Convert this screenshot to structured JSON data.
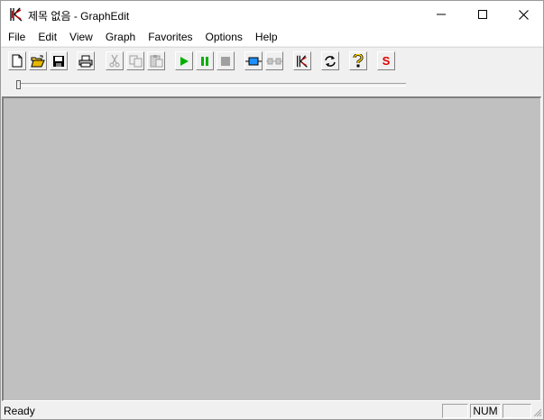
{
  "window": {
    "title": "제목 없음 - GraphEdit",
    "icon": "graphedit-app-icon",
    "controls": [
      "minimize-icon",
      "maximize-icon",
      "close-icon"
    ]
  },
  "menu": {
    "items": [
      "File",
      "Edit",
      "View",
      "Graph",
      "Favorites",
      "Options",
      "Help"
    ]
  },
  "toolbar": {
    "buttons": [
      {
        "name": "new-icon",
        "enabled": true
      },
      {
        "name": "open-folder-icon",
        "enabled": true
      },
      {
        "name": "save-icon",
        "enabled": true
      },
      {
        "name": "print-icon",
        "enabled": true
      },
      {
        "name": "cut-icon",
        "enabled": false
      },
      {
        "name": "copy-icon",
        "enabled": false
      },
      {
        "name": "paste-icon",
        "enabled": false
      },
      {
        "name": "play-icon",
        "enabled": true,
        "color": "#00a000"
      },
      {
        "name": "pause-icon",
        "enabled": true,
        "color": "#00a000"
      },
      {
        "name": "stop-icon",
        "enabled": false
      },
      {
        "name": "filter-connect-icon",
        "enabled": true,
        "color": "#1e90ff"
      },
      {
        "name": "filter-disconnect-icon",
        "enabled": false
      },
      {
        "name": "graphedit-icon",
        "enabled": true
      },
      {
        "name": "refresh-icon",
        "enabled": true
      },
      {
        "name": "help-icon",
        "enabled": true,
        "color": "#ffd800"
      },
      {
        "name": "seek-icon",
        "enabled": true,
        "label": "S",
        "color": "#e00000"
      }
    ]
  },
  "seek": {
    "position": 0
  },
  "statusbar": {
    "text": "Ready",
    "panes": [
      "",
      "NUM",
      ""
    ]
  },
  "colors": {
    "graph_background": "#c0c0c0",
    "chrome": "#f0f0f0"
  }
}
